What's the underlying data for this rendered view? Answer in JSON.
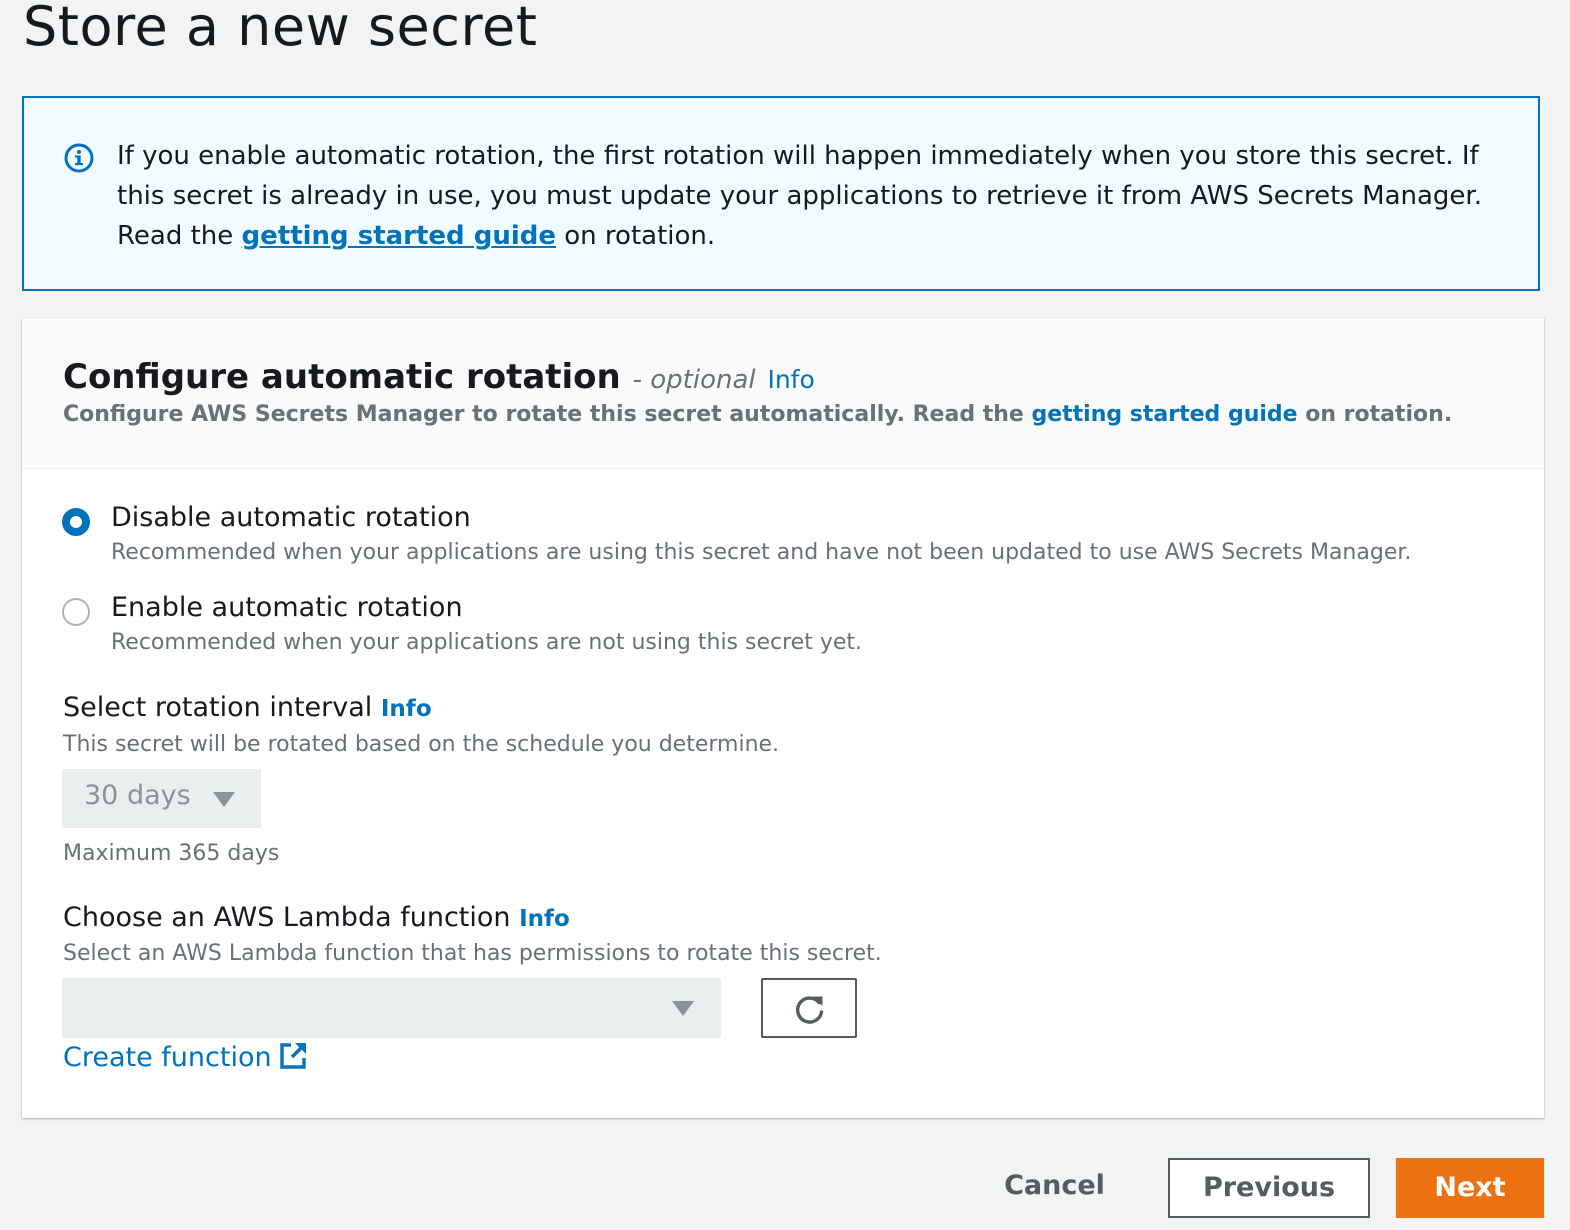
{
  "page": {
    "title": "Store a new secret"
  },
  "alert": {
    "icon": "info-circle-icon",
    "text_before": "If you enable automatic rotation, the first rotation will happen immediately when you store this secret. If this secret is already in use, you must update your applications to retrieve it from AWS Secrets Manager. Read the ",
    "link_text": "getting started guide",
    "text_after": " on rotation."
  },
  "panel": {
    "title": "Configure automatic rotation",
    "optional_label": "- optional",
    "info_label": "Info",
    "description_before": "Configure AWS Secrets Manager to rotate this secret automatically. Read the ",
    "description_link": "getting started guide",
    "description_after": " on rotation."
  },
  "rotation_options": [
    {
      "label": "Disable automatic rotation",
      "description": "Recommended when your applications are using this secret and have not been updated to use AWS Secrets Manager.",
      "selected": true
    },
    {
      "label": "Enable automatic rotation",
      "description": "Recommended when your applications are not using this secret yet.",
      "selected": false
    }
  ],
  "interval": {
    "label": "Select rotation interval",
    "info_label": "Info",
    "description": "This secret will be rotated based on the schedule you determine.",
    "selected_value": "30 days",
    "hint": "Maximum 365 days",
    "disabled": true
  },
  "lambda": {
    "label": "Choose an AWS Lambda function",
    "info_label": "Info",
    "description": "Select an AWS Lambda function that has permissions to rotate this secret.",
    "selected_value": "",
    "refresh_icon": "refresh-icon",
    "create_link": "Create function",
    "create_icon": "external-link-icon",
    "disabled": true
  },
  "footer": {
    "cancel_label": "Cancel",
    "previous_label": "Previous",
    "next_label": "Next"
  },
  "colors": {
    "link": "#0073bb",
    "primary_button": "#ec7211",
    "alert_background": "#f1faff",
    "page_background": "#f2f3f3"
  }
}
